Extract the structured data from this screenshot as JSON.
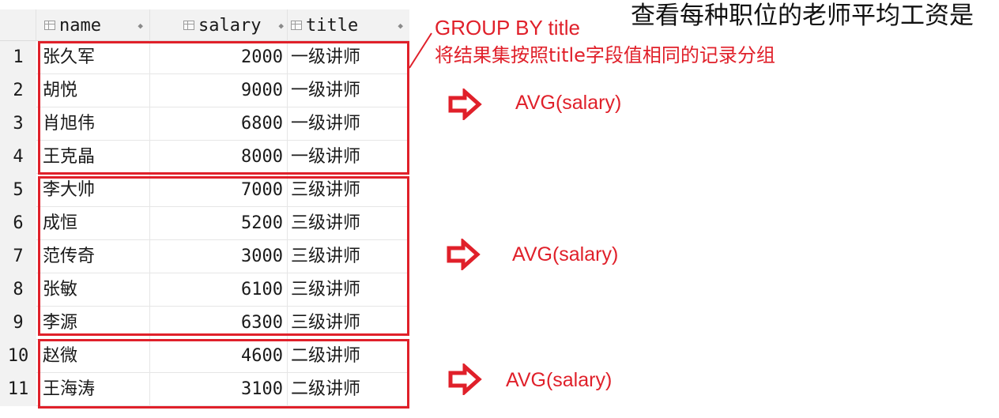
{
  "heading": "查看每种职位的老师平均工资是",
  "columns": [
    {
      "label": "name"
    },
    {
      "label": "salary"
    },
    {
      "label": "title"
    }
  ],
  "rows": [
    {
      "num": "1",
      "name": "张久军",
      "salary": "2000",
      "title": "一级讲师"
    },
    {
      "num": "2",
      "name": "胡悦",
      "salary": "9000",
      "title": "一级讲师"
    },
    {
      "num": "3",
      "name": "肖旭伟",
      "salary": "6800",
      "title": "一级讲师"
    },
    {
      "num": "4",
      "name": "王克晶",
      "salary": "8000",
      "title": "一级讲师"
    },
    {
      "num": "5",
      "name": "李大帅",
      "salary": "7000",
      "title": "三级讲师"
    },
    {
      "num": "6",
      "name": "成恒",
      "salary": "5200",
      "title": "三级讲师"
    },
    {
      "num": "7",
      "name": "范传奇",
      "salary": "3000",
      "title": "三级讲师"
    },
    {
      "num": "8",
      "name": "张敏",
      "salary": "6100",
      "title": "三级讲师"
    },
    {
      "num": "9",
      "name": "李源",
      "salary": "6300",
      "title": "三级讲师"
    },
    {
      "num": "10",
      "name": "赵微",
      "salary": "4600",
      "title": "二级讲师"
    },
    {
      "num": "11",
      "name": "王海涛",
      "salary": "3100",
      "title": "二级讲师"
    }
  ],
  "annotation": {
    "group_by": "GROUP BY title",
    "description": "将结果集按照title字段值相同的记录分组",
    "avg_label_1": "AVG(salary)",
    "avg_label_2": "AVG(salary)",
    "avg_label_3": "AVG(salary)"
  },
  "colors": {
    "accent": "#e0202a"
  }
}
